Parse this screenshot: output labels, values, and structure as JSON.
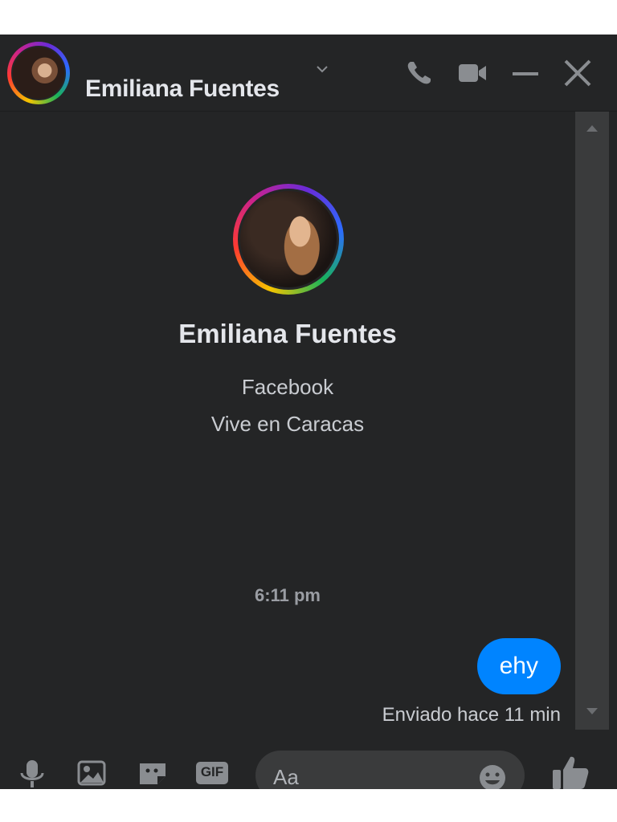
{
  "header": {
    "contact_name": "Emiliana Fuentes",
    "icons": [
      "chevron-down-icon",
      "phone-icon",
      "video-icon",
      "minimize-icon",
      "close-icon"
    ]
  },
  "profile": {
    "name": "Emiliana Fuentes",
    "platform": "Facebook",
    "location": "Vive en Caracas"
  },
  "conversation": {
    "timestamp": "6:11 pm",
    "messages": [
      {
        "text": "ehy",
        "from": "me"
      }
    ],
    "status": "Enviado hace 11 min"
  },
  "composer": {
    "placeholder": "Aa",
    "tools": [
      "microphone-icon",
      "image-icon",
      "sticker-icon",
      "gif-icon"
    ],
    "gif_label": "GIF"
  },
  "colors": {
    "background": "#242526",
    "bubble": "#0084ff",
    "text_primary": "#e4e6eb",
    "text_secondary": "#b0b3b8"
  }
}
